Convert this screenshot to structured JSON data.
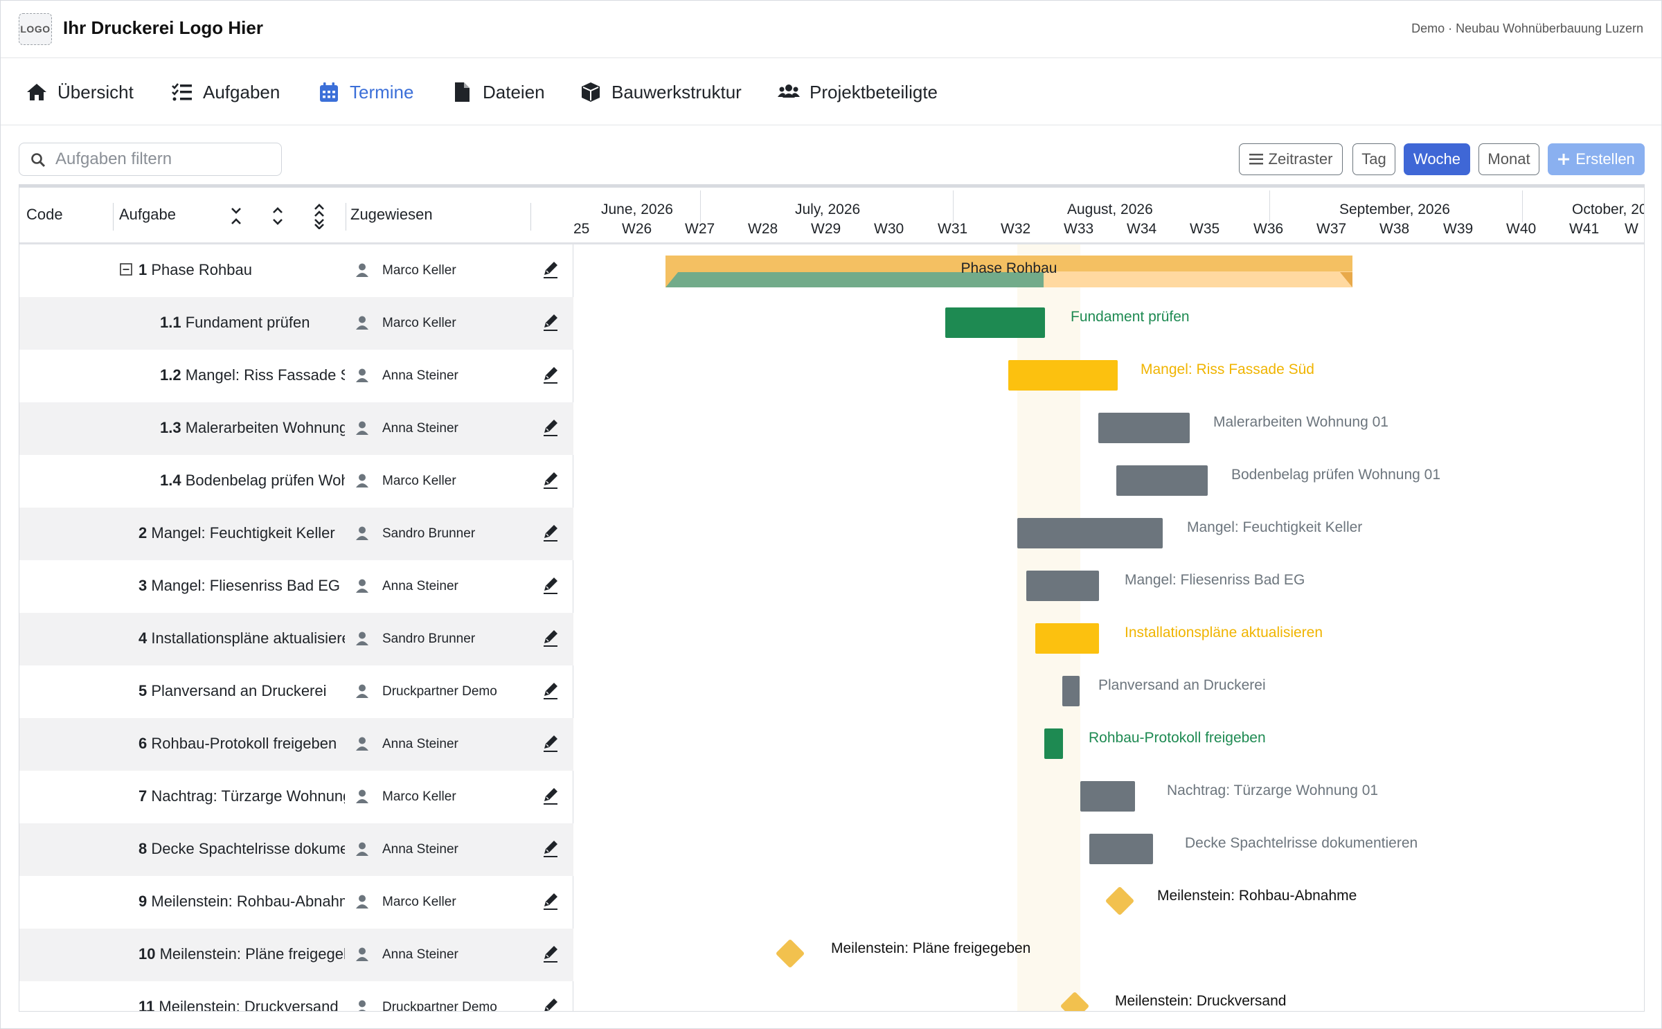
{
  "header": {
    "logo_text": "LOGO",
    "title": "Ihr Druckerei Logo Hier",
    "project": "Demo · Neubau Wohnüberbauung Luzern"
  },
  "nav": {
    "items": [
      {
        "label": "Übersicht",
        "icon": "home-icon"
      },
      {
        "label": "Aufgaben",
        "icon": "task-list-icon"
      },
      {
        "label": "Termine",
        "icon": "calendar-icon",
        "active": true
      },
      {
        "label": "Dateien",
        "icon": "file-icon"
      },
      {
        "label": "Bauwerkstruktur",
        "icon": "cube-icon"
      },
      {
        "label": "Projektbeteiligte",
        "icon": "users-icon"
      }
    ]
  },
  "toolbar": {
    "filter_placeholder": "Aufgaben filtern",
    "zeitraster": "Zeitraster",
    "tag": "Tag",
    "woche": "Woche",
    "monat": "Monat",
    "erstellen": "Erstellen",
    "accent": "#3f67d6"
  },
  "grid": {
    "columns": {
      "code": "Code",
      "task": "Aufgabe",
      "assigned": "Zugewiesen"
    },
    "rows": [
      {
        "code": "1",
        "name": "Phase Rohbau",
        "assignee": "Marco Keller",
        "level": 0,
        "group": true
      },
      {
        "code": "1.1",
        "name": "Fundament prüfen",
        "assignee": "Marco Keller",
        "level": 1
      },
      {
        "code": "1.2",
        "name": "Mangel: Riss Fassade S",
        "assignee": "Anna Steiner",
        "level": 1
      },
      {
        "code": "1.3",
        "name": "Malerarbeiten Wohnung",
        "assignee": "Anna Steiner",
        "level": 1
      },
      {
        "code": "1.4",
        "name": "Bodenbelag prüfen Woh",
        "assignee": "Marco Keller",
        "level": 1
      },
      {
        "code": "2",
        "name": "Mangel: Feuchtigkeit Keller",
        "assignee": "Sandro Brunner",
        "level": 0
      },
      {
        "code": "3",
        "name": "Mangel: Fliesenriss Bad EG",
        "assignee": "Anna Steiner",
        "level": 0
      },
      {
        "code": "4",
        "name": "Installationspläne aktualisiere",
        "assignee": "Sandro Brunner",
        "level": 0
      },
      {
        "code": "5",
        "name": "Planversand an Druckerei",
        "assignee": "Druckpartner Demo",
        "level": 0
      },
      {
        "code": "6",
        "name": "Rohbau-Protokoll freigeben",
        "assignee": "Anna Steiner",
        "level": 0
      },
      {
        "code": "7",
        "name": "Nachtrag: Türzarge Wohnung",
        "assignee": "Marco Keller",
        "level": 0
      },
      {
        "code": "8",
        "name": "Decke Spachtelrisse dokumei",
        "assignee": "Anna Steiner",
        "level": 0
      },
      {
        "code": "9",
        "name": "Meilenstein: Rohbau-Abnahm",
        "assignee": "Marco Keller",
        "level": 0
      },
      {
        "code": "10",
        "name": "Meilenstein: Pläne freigegeb",
        "assignee": "Anna Steiner",
        "level": 0
      },
      {
        "code": "11",
        "name": "Meilenstein: Druckversand",
        "assignee": "Druckpartner Demo",
        "level": 0
      }
    ]
  },
  "timeline": {
    "months": [
      "June, 2026",
      "July, 2026",
      "August, 2026",
      "September, 2026",
      "October, 20"
    ],
    "weeks": [
      "25",
      "W26",
      "W27",
      "W28",
      "W29",
      "W30",
      "W31",
      "W32",
      "W33",
      "W34",
      "W35",
      "W36",
      "W37",
      "W38",
      "W39",
      "W40",
      "W41",
      "W"
    ],
    "bars": [
      {
        "label": "Phase Rohbau",
        "type": "summary",
        "progress": 0.55
      },
      {
        "label": "Fundament prüfen",
        "type": "task",
        "color": "#1e8a52",
        "label_color": "#1e8a52"
      },
      {
        "label": "Mangel: Riss Fassade Süd",
        "type": "task",
        "color": "#fcc10f",
        "label_color": "#f0b400"
      },
      {
        "label": "Malerarbeiten Wohnung 01",
        "type": "task",
        "color": "#6c757d",
        "label_color": "#6c757d"
      },
      {
        "label": "Bodenbelag prüfen Wohnung 01",
        "type": "task",
        "color": "#6c757d",
        "label_color": "#6c757d"
      },
      {
        "label": "Mangel: Feuchtigkeit Keller",
        "type": "task",
        "color": "#6c757d",
        "label_color": "#6c757d"
      },
      {
        "label": "Mangel: Fliesenriss Bad EG",
        "type": "task",
        "color": "#6c757d",
        "label_color": "#6c757d"
      },
      {
        "label": "Installationspläne aktualisieren",
        "type": "task",
        "color": "#fcc10f",
        "label_color": "#f0b400"
      },
      {
        "label": "Planversand an Druckerei",
        "type": "task",
        "color": "#6c757d",
        "label_color": "#6c757d"
      },
      {
        "label": "Rohbau-Protokoll freigeben",
        "type": "task",
        "color": "#1e8a52",
        "label_color": "#1e8a52"
      },
      {
        "label": "Nachtrag: Türzarge Wohnung 01",
        "type": "task",
        "color": "#6c757d",
        "label_color": "#6c757d"
      },
      {
        "label": "Decke Spachtelrisse dokumentieren",
        "type": "task",
        "color": "#6c757d",
        "label_color": "#6c757d"
      },
      {
        "label": "Meilenstein: Rohbau-Abnahme",
        "type": "milestone",
        "color": "#f2c14e",
        "label_color": "#111111"
      },
      {
        "label": "Meilenstein: Pläne freigegeben",
        "type": "milestone",
        "color": "#f2c14e",
        "label_color": "#111111"
      },
      {
        "label": "Meilenstein: Druckversand",
        "type": "milestone",
        "color": "#f2c14e",
        "label_color": "#111111"
      }
    ]
  }
}
